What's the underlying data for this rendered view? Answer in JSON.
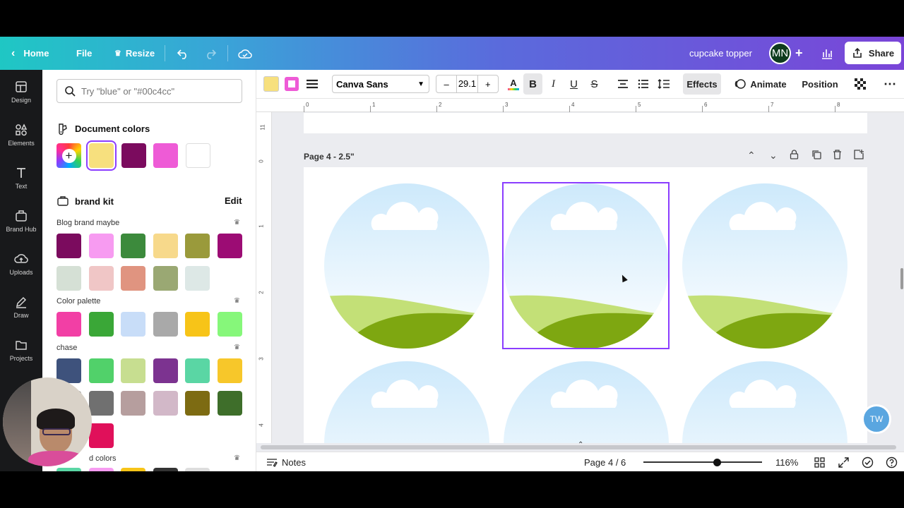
{
  "topbar": {
    "home": "Home",
    "file": "File",
    "resize": "Resize",
    "doc_title": "cupcake topper",
    "avatar_initials": "MN",
    "share": "Share",
    "gradient_start": "#1fc7c4",
    "gradient_end": "#7a45d8"
  },
  "rail": {
    "items": [
      {
        "label": "Design",
        "icon": "layout-icon"
      },
      {
        "label": "Elements",
        "icon": "shapes-icon"
      },
      {
        "label": "Text",
        "icon": "text-icon"
      },
      {
        "label": "Brand Hub",
        "icon": "brand-icon"
      },
      {
        "label": "Uploads",
        "icon": "upload-icon"
      },
      {
        "label": "Draw",
        "icon": "pen-icon"
      },
      {
        "label": "Projects",
        "icon": "folder-icon"
      }
    ]
  },
  "panel": {
    "search_placeholder": "Try \"blue\" or \"#00c4cc\"",
    "document_colors_title": "Document colors",
    "document_colors": [
      "#f7e07e",
      "#7b0b5e",
      "#ee5bd6",
      "#ffffff"
    ],
    "brand_kit_title": "brand kit",
    "edit": "Edit",
    "groups": [
      {
        "label": "Blog brand maybe",
        "colors": [
          "#7b0b5e",
          "#f79bf1",
          "#3c8a3c",
          "#f7d98b",
          "#9a9a3b",
          "#9c0c74",
          "#d5e0d5",
          "#f0c6c6",
          "#e09480",
          "#9aa873",
          "#dde8e6"
        ]
      },
      {
        "label": "Color palette",
        "colors": [
          "#f23fa5",
          "#3aa737",
          "#c8ddf8",
          "#a9a9a9",
          "#f7c418",
          "#86f77a"
        ]
      },
      {
        "label": "chase",
        "colors": [
          "#3e527c",
          "#51d16a",
          "#c7de90",
          "#7c3390",
          "#5ad6a4",
          "#f7c72a",
          "#777777",
          "#707070",
          "#b69e9e",
          "#d2b8c8",
          "#7d6b12",
          "#3e6e2a",
          "#e81ee0",
          "#e0105a"
        ]
      }
    ],
    "last_group_partial": "d colors"
  },
  "toolbar": {
    "font": "Canva Sans",
    "size": "29.1",
    "minus": "–",
    "plus": "+",
    "bold": "B",
    "italic": "I",
    "underline": "U",
    "strike": "S",
    "effects": "Effects",
    "animate": "Animate",
    "position": "Position",
    "text_color": "#f7e07e",
    "outline_color": "#ee5bd6"
  },
  "canvas": {
    "hruler_ticks": [
      "0",
      "1",
      "2",
      "3",
      "4",
      "5",
      "6",
      "7",
      "8"
    ],
    "vruler_ticks": [
      "11",
      "0",
      "1",
      "2",
      "3",
      "4"
    ],
    "page_label": "Page 4 - 2.5\"",
    "sky_top": "#cde9fb",
    "grass_light": "#c3e077",
    "grass_dark": "#7ea711",
    "selection_color": "#8b3dff"
  },
  "footer": {
    "notes": "Notes",
    "page_indicator": "Page 4 / 6",
    "zoom": "116%"
  },
  "misc": {
    "help_badge": "TW"
  }
}
